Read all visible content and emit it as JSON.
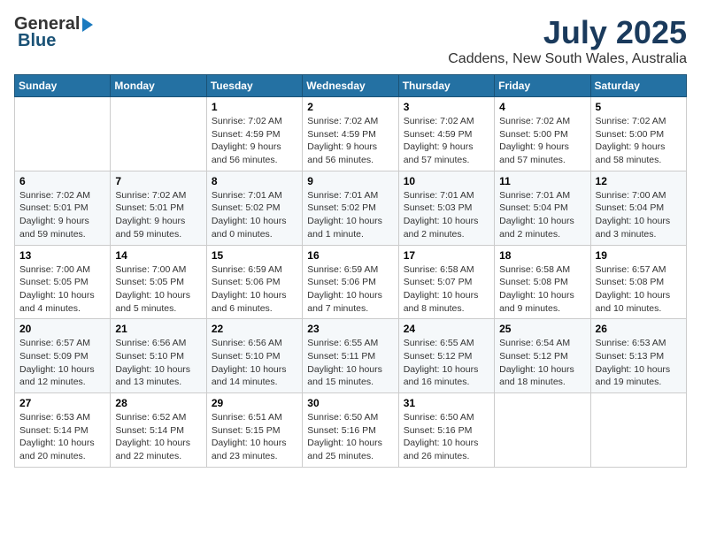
{
  "logo": {
    "general": "General",
    "blue": "Blue"
  },
  "title": {
    "month_year": "July 2025",
    "location": "Caddens, New South Wales, Australia"
  },
  "headers": [
    "Sunday",
    "Monday",
    "Tuesday",
    "Wednesday",
    "Thursday",
    "Friday",
    "Saturday"
  ],
  "weeks": [
    [
      {
        "day": "",
        "info": ""
      },
      {
        "day": "",
        "info": ""
      },
      {
        "day": "1",
        "sunrise": "7:02 AM",
        "sunset": "4:59 PM",
        "daylight": "9 hours and 56 minutes."
      },
      {
        "day": "2",
        "sunrise": "7:02 AM",
        "sunset": "4:59 PM",
        "daylight": "9 hours and 56 minutes."
      },
      {
        "day": "3",
        "sunrise": "7:02 AM",
        "sunset": "4:59 PM",
        "daylight": "9 hours and 57 minutes."
      },
      {
        "day": "4",
        "sunrise": "7:02 AM",
        "sunset": "5:00 PM",
        "daylight": "9 hours and 57 minutes."
      },
      {
        "day": "5",
        "sunrise": "7:02 AM",
        "sunset": "5:00 PM",
        "daylight": "9 hours and 58 minutes."
      }
    ],
    [
      {
        "day": "6",
        "sunrise": "7:02 AM",
        "sunset": "5:01 PM",
        "daylight": "9 hours and 59 minutes."
      },
      {
        "day": "7",
        "sunrise": "7:02 AM",
        "sunset": "5:01 PM",
        "daylight": "9 hours and 59 minutes."
      },
      {
        "day": "8",
        "sunrise": "7:01 AM",
        "sunset": "5:02 PM",
        "daylight": "10 hours and 0 minutes."
      },
      {
        "day": "9",
        "sunrise": "7:01 AM",
        "sunset": "5:02 PM",
        "daylight": "10 hours and 1 minute."
      },
      {
        "day": "10",
        "sunrise": "7:01 AM",
        "sunset": "5:03 PM",
        "daylight": "10 hours and 2 minutes."
      },
      {
        "day": "11",
        "sunrise": "7:01 AM",
        "sunset": "5:04 PM",
        "daylight": "10 hours and 2 minutes."
      },
      {
        "day": "12",
        "sunrise": "7:00 AM",
        "sunset": "5:04 PM",
        "daylight": "10 hours and 3 minutes."
      }
    ],
    [
      {
        "day": "13",
        "sunrise": "7:00 AM",
        "sunset": "5:05 PM",
        "daylight": "10 hours and 4 minutes."
      },
      {
        "day": "14",
        "sunrise": "7:00 AM",
        "sunset": "5:05 PM",
        "daylight": "10 hours and 5 minutes."
      },
      {
        "day": "15",
        "sunrise": "6:59 AM",
        "sunset": "5:06 PM",
        "daylight": "10 hours and 6 minutes."
      },
      {
        "day": "16",
        "sunrise": "6:59 AM",
        "sunset": "5:06 PM",
        "daylight": "10 hours and 7 minutes."
      },
      {
        "day": "17",
        "sunrise": "6:58 AM",
        "sunset": "5:07 PM",
        "daylight": "10 hours and 8 minutes."
      },
      {
        "day": "18",
        "sunrise": "6:58 AM",
        "sunset": "5:08 PM",
        "daylight": "10 hours and 9 minutes."
      },
      {
        "day": "19",
        "sunrise": "6:57 AM",
        "sunset": "5:08 PM",
        "daylight": "10 hours and 10 minutes."
      }
    ],
    [
      {
        "day": "20",
        "sunrise": "6:57 AM",
        "sunset": "5:09 PM",
        "daylight": "10 hours and 12 minutes."
      },
      {
        "day": "21",
        "sunrise": "6:56 AM",
        "sunset": "5:10 PM",
        "daylight": "10 hours and 13 minutes."
      },
      {
        "day": "22",
        "sunrise": "6:56 AM",
        "sunset": "5:10 PM",
        "daylight": "10 hours and 14 minutes."
      },
      {
        "day": "23",
        "sunrise": "6:55 AM",
        "sunset": "5:11 PM",
        "daylight": "10 hours and 15 minutes."
      },
      {
        "day": "24",
        "sunrise": "6:55 AM",
        "sunset": "5:12 PM",
        "daylight": "10 hours and 16 minutes."
      },
      {
        "day": "25",
        "sunrise": "6:54 AM",
        "sunset": "5:12 PM",
        "daylight": "10 hours and 18 minutes."
      },
      {
        "day": "26",
        "sunrise": "6:53 AM",
        "sunset": "5:13 PM",
        "daylight": "10 hours and 19 minutes."
      }
    ],
    [
      {
        "day": "27",
        "sunrise": "6:53 AM",
        "sunset": "5:14 PM",
        "daylight": "10 hours and 20 minutes."
      },
      {
        "day": "28",
        "sunrise": "6:52 AM",
        "sunset": "5:14 PM",
        "daylight": "10 hours and 22 minutes."
      },
      {
        "day": "29",
        "sunrise": "6:51 AM",
        "sunset": "5:15 PM",
        "daylight": "10 hours and 23 minutes."
      },
      {
        "day": "30",
        "sunrise": "6:50 AM",
        "sunset": "5:16 PM",
        "daylight": "10 hours and 25 minutes."
      },
      {
        "day": "31",
        "sunrise": "6:50 AM",
        "sunset": "5:16 PM",
        "daylight": "10 hours and 26 minutes."
      },
      {
        "day": "",
        "info": ""
      },
      {
        "day": "",
        "info": ""
      }
    ]
  ],
  "labels": {
    "sunrise_prefix": "Sunrise: ",
    "sunset_prefix": "Sunset: ",
    "daylight_prefix": "Daylight: "
  }
}
